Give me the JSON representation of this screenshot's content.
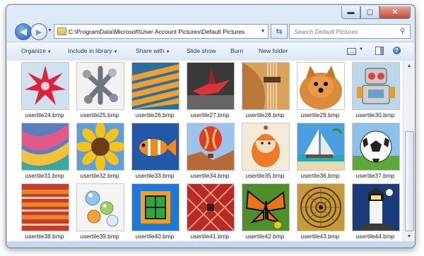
{
  "window": {
    "minimize_icon": "minimize-icon",
    "maximize_icon": "maximize-icon",
    "close_icon": "close-icon"
  },
  "nav": {
    "address": "C:\\ProgramData\\Microsoft\\User Account Pictures\\Default Pictures",
    "search_placeholder": "Search Default Pictures"
  },
  "toolbar": {
    "organize": "Organize",
    "include_in_library": "Include in library",
    "share_with": "Share with",
    "slide_show": "Slide show",
    "burn": "Burn",
    "new_folder": "New folder"
  },
  "files": [
    {
      "name": "usertile24.bmp",
      "icon": "red-star-flower"
    },
    {
      "name": "usertile25.bmp",
      "icon": "metal-jacks"
    },
    {
      "name": "usertile26.bmp",
      "icon": "orange-stairs"
    },
    {
      "name": "usertile27.bmp",
      "icon": "origami-crane"
    },
    {
      "name": "usertile28.bmp",
      "icon": "guitar"
    },
    {
      "name": "usertile29.bmp",
      "icon": "pomeranian-dog"
    },
    {
      "name": "usertile30.bmp",
      "icon": "toy-robot"
    },
    {
      "name": "usertile31.bmp",
      "icon": "colorful-scarf"
    },
    {
      "name": "usertile32.bmp",
      "icon": "sunflower"
    },
    {
      "name": "usertile33.bmp",
      "icon": "clownfish"
    },
    {
      "name": "usertile34.bmp",
      "icon": "hot-air-balloon"
    },
    {
      "name": "usertile35.bmp",
      "icon": "doll-figure"
    },
    {
      "name": "usertile36.bmp",
      "icon": "sailboat"
    },
    {
      "name": "usertile37.bmp",
      "icon": "soccer-ball"
    },
    {
      "name": "usertile38.bmp",
      "icon": "striped-fabric"
    },
    {
      "name": "usertile39.bmp",
      "icon": "glass-marbles"
    },
    {
      "name": "usertile40.bmp",
      "icon": "green-window"
    },
    {
      "name": "usertile41.bmp",
      "icon": "red-woven-textile"
    },
    {
      "name": "usertile42.bmp",
      "icon": "monarch-butterfly"
    },
    {
      "name": "usertile43.bmp",
      "icon": "spiral-staircase"
    },
    {
      "name": "usertile44.bmp",
      "icon": "lighthouse"
    }
  ]
}
